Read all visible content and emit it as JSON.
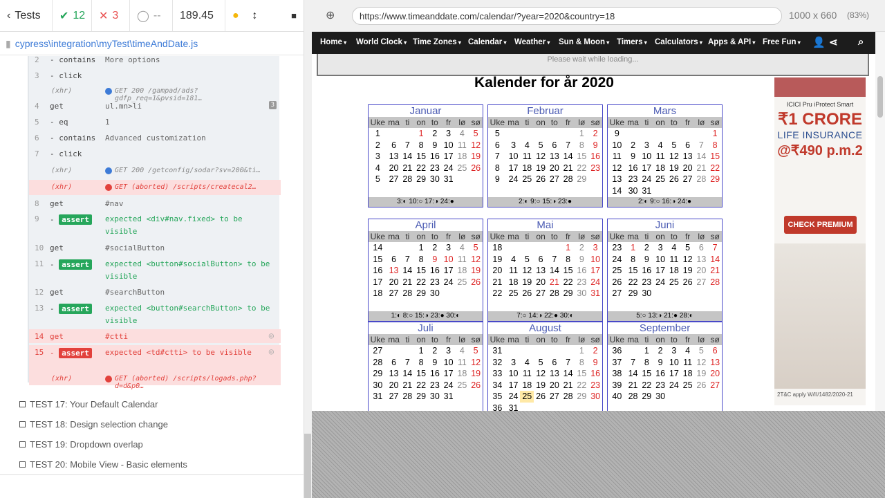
{
  "reporter": {
    "tests_label": "Tests",
    "passed": "12",
    "failed": "3",
    "pending": "--",
    "duration": "189.45",
    "spec_path": "cypress\\integration\\myTest\\timeAndDate.js",
    "log": [
      {
        "num": "2",
        "cmd": "- contains",
        "arg": "More options"
      },
      {
        "num": "3",
        "cmd": "- click",
        "arg": ""
      },
      {
        "xhr": "(xhr)",
        "text": "GET 200 /gampad/ads?gdfp_req=1&pvsid=181…"
      },
      {
        "num": "4",
        "cmd": "get",
        "arg": "ul.mn>li",
        "count": "3"
      },
      {
        "num": "5",
        "cmd": "- eq",
        "arg": "1"
      },
      {
        "num": "6",
        "cmd": "- contains",
        "arg": "Advanced customization"
      },
      {
        "num": "7",
        "cmd": "- click",
        "arg": ""
      },
      {
        "xhr": "(xhr)",
        "text": "GET 200 /getconfig/sodar?sv=200&ti…"
      },
      {
        "xhr": "(xhr)",
        "text": "GET (aborted) /scripts/createcal2…"
      },
      {
        "num": "8",
        "cmd": "get",
        "arg": "#nav"
      },
      {
        "num": "9",
        "cmd": "assert",
        "arg": "expected <div#nav.fixed> to be visible"
      },
      {
        "num": "10",
        "cmd": "get",
        "arg": "#socialButton"
      },
      {
        "num": "11",
        "cmd": "assert",
        "arg": "expected <button#socialButton> to be visible"
      },
      {
        "num": "12",
        "cmd": "get",
        "arg": "#searchButton"
      },
      {
        "num": "13",
        "cmd": "assert",
        "arg": "expected <button#searchButton> to be visible"
      },
      {
        "num": "14",
        "cmd": "get",
        "arg": "#ctti"
      },
      {
        "num": "15",
        "cmd": "assert",
        "arg": "expected <td#ctti> to be visible"
      },
      {
        "xhr": "(xhr)",
        "text": "GET (aborted) /scripts/logads.php?d=d&p0…"
      }
    ],
    "tests": [
      "TEST 17: Your Default Calendar",
      "TEST 18: Design selection change",
      "TEST 19: Dropdown overlap",
      "TEST 20: Mobile View - Basic elements"
    ]
  },
  "browser": {
    "url": "https://www.timeanddate.com/calendar/?year=2020&country=18",
    "viewport": "1000 x 660",
    "zoom": "(83%)"
  },
  "site": {
    "nav": [
      "Home",
      "World Clock",
      "Time Zones",
      "Calendar",
      "Weather",
      "Sun & Moon",
      "Timers",
      "Calculators",
      "Apps & API",
      "Free Fun"
    ],
    "loading": "Please wait while loading...",
    "title": "Kalender for år 2020",
    "weekday_header": [
      "Uke",
      "ma",
      "ti",
      "on",
      "to",
      "fr",
      "lø",
      "sø"
    ],
    "months": [
      {
        "name": "Januar",
        "weeks": [
          [
            "1",
            "",
            "",
            "1",
            "2",
            "3",
            "4",
            "5"
          ],
          [
            "2",
            "6",
            "7",
            "8",
            "9",
            "10",
            "11",
            "12"
          ],
          [
            "3",
            "13",
            "14",
            "15",
            "16",
            "17",
            "18",
            "19"
          ],
          [
            "4",
            "20",
            "21",
            "22",
            "23",
            "24",
            "25",
            "26"
          ],
          [
            "5",
            "27",
            "28",
            "29",
            "30",
            "31",
            "",
            ""
          ]
        ],
        "phases": "3:◐  10:○  17:◑  24:●"
      },
      {
        "name": "Februar",
        "weeks": [
          [
            "5",
            "",
            "",
            "",
            "",
            "",
            "1",
            "2"
          ],
          [
            "6",
            "3",
            "4",
            "5",
            "6",
            "7",
            "8",
            "9"
          ],
          [
            "7",
            "10",
            "11",
            "12",
            "13",
            "14",
            "15",
            "16"
          ],
          [
            "8",
            "17",
            "18",
            "19",
            "20",
            "21",
            "22",
            "23"
          ],
          [
            "9",
            "24",
            "25",
            "26",
            "27",
            "28",
            "29",
            ""
          ]
        ],
        "phases": "2:◐  9:○  15:◑  23:●"
      },
      {
        "name": "Mars",
        "weeks": [
          [
            "9",
            "",
            "",
            "",
            "",
            "",
            "",
            "1"
          ],
          [
            "10",
            "2",
            "3",
            "4",
            "5",
            "6",
            "7",
            "8"
          ],
          [
            "11",
            "9",
            "10",
            "11",
            "12",
            "13",
            "14",
            "15"
          ],
          [
            "12",
            "16",
            "17",
            "18",
            "19",
            "20",
            "21",
            "22"
          ],
          [
            "13",
            "23",
            "24",
            "25",
            "26",
            "27",
            "28",
            "29"
          ],
          [
            "14",
            "30",
            "31",
            "",
            "",
            "",
            "",
            ""
          ]
        ],
        "phases": "2:◐  9:○  16:◑  24:●"
      },
      {
        "name": "April",
        "weeks": [
          [
            "14",
            "",
            "",
            "1",
            "2",
            "3",
            "4",
            "5"
          ],
          [
            "15",
            "6",
            "7",
            "8",
            "9",
            "10",
            "11",
            "12"
          ],
          [
            "16",
            "13",
            "14",
            "15",
            "16",
            "17",
            "18",
            "19"
          ],
          [
            "17",
            "20",
            "21",
            "22",
            "23",
            "24",
            "25",
            "26"
          ],
          [
            "18",
            "27",
            "28",
            "29",
            "30",
            "",
            "",
            ""
          ]
        ],
        "phases": "1:◐  8:○  15:◑  23:●  30:◐"
      },
      {
        "name": "Mai",
        "weeks": [
          [
            "18",
            "",
            "",
            "",
            "",
            "1",
            "2",
            "3"
          ],
          [
            "19",
            "4",
            "5",
            "6",
            "7",
            "8",
            "9",
            "10"
          ],
          [
            "20",
            "11",
            "12",
            "13",
            "14",
            "15",
            "16",
            "17"
          ],
          [
            "21",
            "18",
            "19",
            "20",
            "21",
            "22",
            "23",
            "24"
          ],
          [
            "22",
            "25",
            "26",
            "27",
            "28",
            "29",
            "30",
            "31"
          ]
        ],
        "phases": "7:○  14:◑  22:●  30:◐"
      },
      {
        "name": "Juni",
        "weeks": [
          [
            "23",
            "1",
            "2",
            "3",
            "4",
            "5",
            "6",
            "7"
          ],
          [
            "24",
            "8",
            "9",
            "10",
            "11",
            "12",
            "13",
            "14"
          ],
          [
            "25",
            "15",
            "16",
            "17",
            "18",
            "19",
            "20",
            "21"
          ],
          [
            "26",
            "22",
            "23",
            "24",
            "25",
            "26",
            "27",
            "28"
          ],
          [
            "27",
            "29",
            "30",
            "",
            "",
            "",
            "",
            ""
          ]
        ],
        "phases": "5:○  13:◑  21:●  28:◐"
      },
      {
        "name": "Juli",
        "weeks": [
          [
            "27",
            "",
            "",
            "1",
            "2",
            "3",
            "4",
            "5"
          ],
          [
            "28",
            "6",
            "7",
            "8",
            "9",
            "10",
            "11",
            "12"
          ],
          [
            "29",
            "13",
            "14",
            "15",
            "16",
            "17",
            "18",
            "19"
          ],
          [
            "30",
            "20",
            "21",
            "22",
            "23",
            "24",
            "25",
            "26"
          ],
          [
            "31",
            "27",
            "28",
            "29",
            "30",
            "31",
            "",
            ""
          ]
        ],
        "phases": ""
      },
      {
        "name": "August",
        "weeks": [
          [
            "31",
            "",
            "",
            "",
            "",
            "",
            "1",
            "2"
          ],
          [
            "32",
            "3",
            "4",
            "5",
            "6",
            "7",
            "8",
            "9"
          ],
          [
            "33",
            "10",
            "11",
            "12",
            "13",
            "14",
            "15",
            "16"
          ],
          [
            "34",
            "17",
            "18",
            "19",
            "20",
            "21",
            "22",
            "23"
          ],
          [
            "35",
            "24",
            "25",
            "26",
            "27",
            "28",
            "29",
            "30"
          ],
          [
            "36",
            "31",
            "",
            "",
            "",
            "",
            "",
            ""
          ]
        ],
        "phases": ""
      },
      {
        "name": "September",
        "weeks": [
          [
            "36",
            "",
            "1",
            "2",
            "3",
            "4",
            "5",
            "6"
          ],
          [
            "37",
            "7",
            "8",
            "9",
            "10",
            "11",
            "12",
            "13"
          ],
          [
            "38",
            "14",
            "15",
            "16",
            "17",
            "18",
            "19",
            "20"
          ],
          [
            "39",
            "21",
            "22",
            "23",
            "24",
            "25",
            "26",
            "27"
          ],
          [
            "40",
            "28",
            "29",
            "30",
            "",
            "",
            "",
            ""
          ]
        ],
        "phases": ""
      }
    ],
    "ad": {
      "brand": "ICICI Pru iProtect Smart",
      "headline": "₹1 CRORE",
      "sub": "LIFE INSURANCE",
      "price": "@₹490 p.m.2",
      "cta": "CHECK PREMIUM",
      "foot": "2T&C apply W/II/1482/2020-21"
    }
  },
  "colors": {
    "pass": "#26a65b",
    "fail": "#e2413c",
    "link": "#3d7bd7",
    "month": "#4b5bb3",
    "nav": "#1c1c1c"
  }
}
